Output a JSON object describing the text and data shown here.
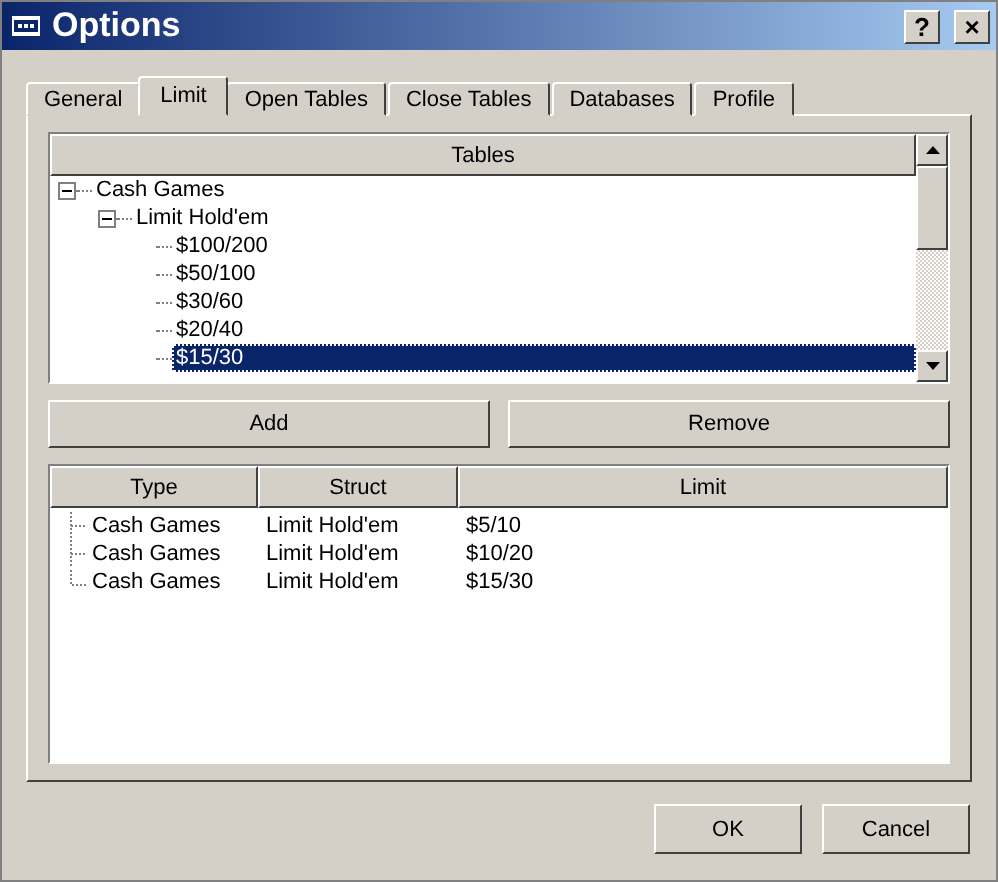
{
  "window": {
    "title": "Options",
    "help": "?",
    "close": "×"
  },
  "tabs": [
    {
      "label": "General",
      "selected": false
    },
    {
      "label": "Limit",
      "selected": true
    },
    {
      "label": "Open Tables",
      "selected": false
    },
    {
      "label": "Close Tables",
      "selected": false
    },
    {
      "label": "Databases",
      "selected": false
    },
    {
      "label": "Profile",
      "selected": false
    }
  ],
  "tables": {
    "header": "Tables",
    "tree": [
      {
        "label": "Cash Games",
        "expanded": true,
        "selected": false,
        "children": [
          {
            "label": "Limit Hold'em",
            "expanded": true,
            "selected": false,
            "children": [
              {
                "label": "$100/200",
                "selected": false
              },
              {
                "label": "$50/100",
                "selected": false
              },
              {
                "label": "$30/60",
                "selected": false
              },
              {
                "label": "$20/40",
                "selected": false
              },
              {
                "label": "$15/30",
                "selected": true
              }
            ]
          }
        ]
      }
    ]
  },
  "actions": [
    "Add",
    "Remove"
  ],
  "list": {
    "columns": [
      "Type",
      "Struct",
      "Limit"
    ],
    "rows": [
      [
        "Cash Games",
        "Limit Hold'em",
        "$5/10"
      ],
      [
        "Cash Games",
        "Limit Hold'em",
        "$10/20"
      ],
      [
        "Cash Games",
        "Limit Hold'em",
        "$15/30"
      ]
    ]
  },
  "buttons": [
    "OK",
    "Cancel"
  ]
}
